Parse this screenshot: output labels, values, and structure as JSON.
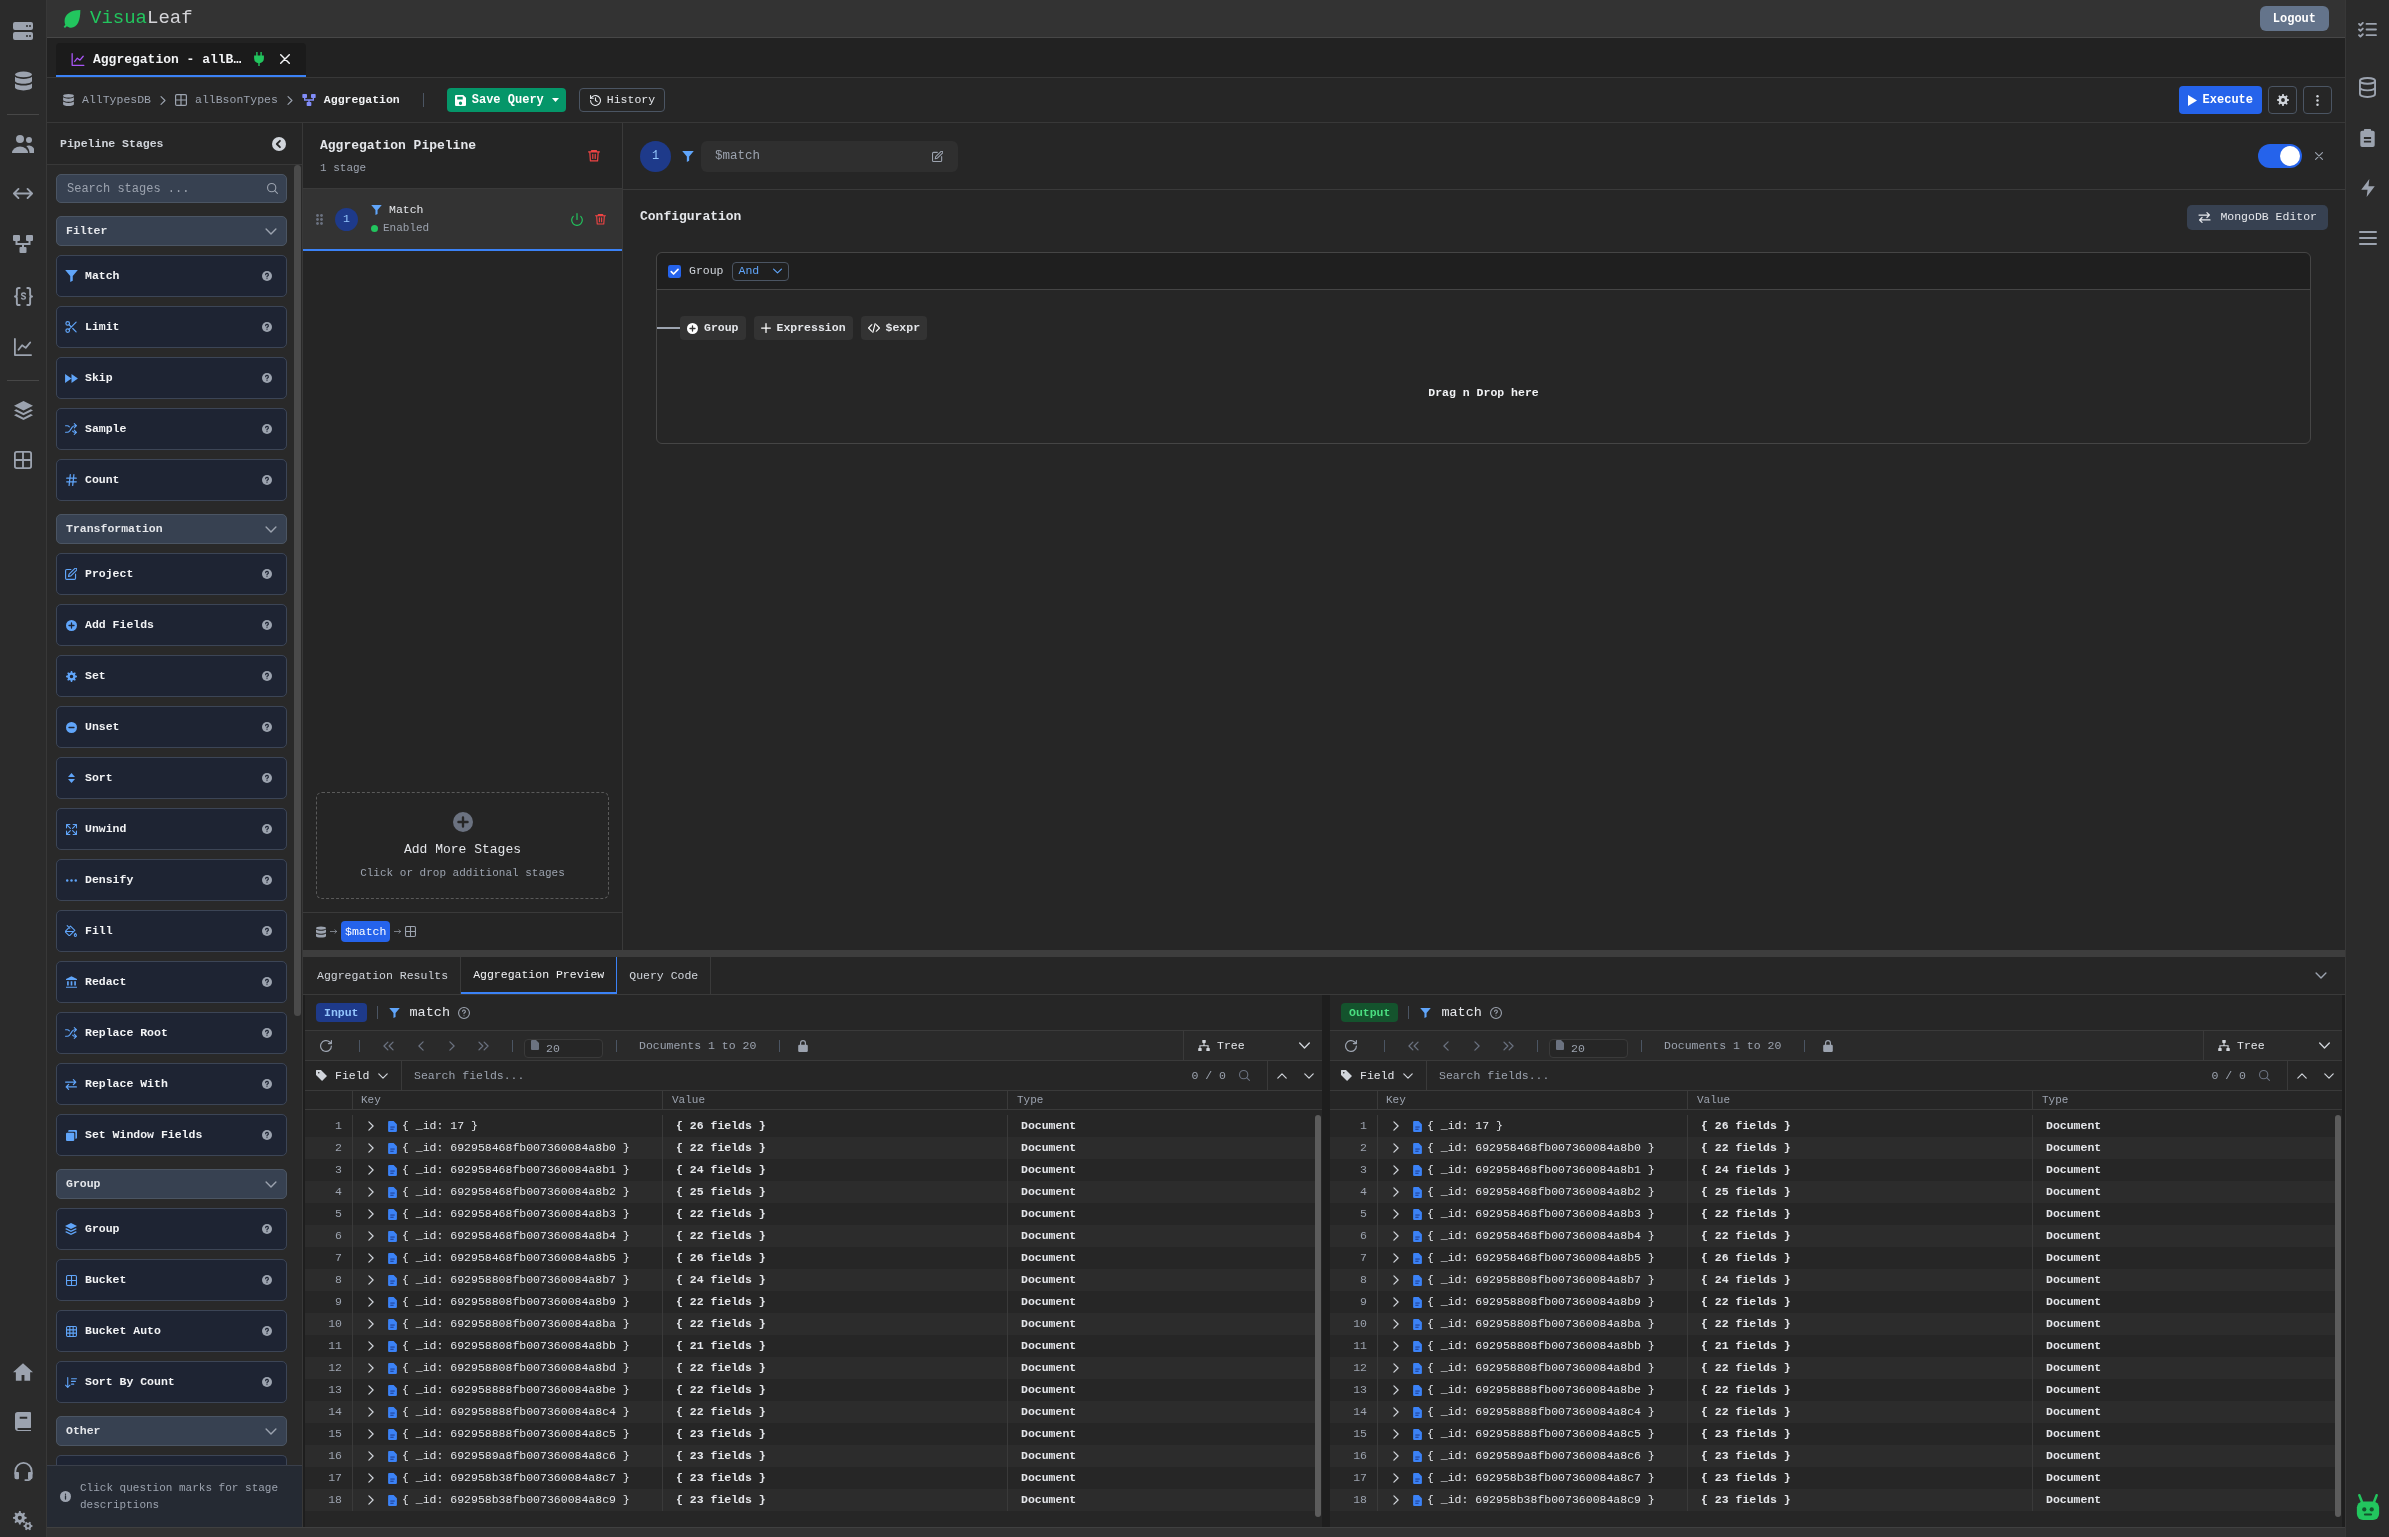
{
  "header": {
    "logo": {
      "accent": "Visua",
      "rest": "Leaf"
    },
    "logout": "Logout"
  },
  "tabs": [
    {
      "label": "Aggregation - allB…",
      "selected": true,
      "connected": true
    }
  ],
  "breadcrumb": [
    {
      "kind": "database",
      "label": "AllTypesDB"
    },
    {
      "kind": "collection",
      "label": "allBsonTypes"
    },
    {
      "kind": "pipeline",
      "label": "Aggregation"
    }
  ],
  "toolbar": {
    "save": "Save Query",
    "history": "History",
    "execute": "Execute"
  },
  "stage_palette": {
    "title": "Pipeline Stages",
    "search": {
      "placeholder": "Search stages ..."
    },
    "categories": [
      {
        "label": "Filter",
        "expanded": true,
        "stages": [
          "Match",
          "Limit",
          "Skip",
          "Sample",
          "Count"
        ]
      },
      {
        "label": "Transformation",
        "expanded": true,
        "stages": [
          "Project",
          "Add Fields",
          "Set",
          "Unset",
          "Sort",
          "Unwind",
          "Densify",
          "Fill",
          "Redact",
          "Replace Root",
          "Replace With",
          "Set Window Fields"
        ]
      },
      {
        "label": "Group",
        "expanded": true,
        "stages": [
          "Group",
          "Bucket",
          "Bucket Auto",
          "Sort By Count"
        ]
      },
      {
        "label": "Other",
        "expanded": true
      }
    ],
    "hint": "Click question marks for stage descriptions"
  },
  "pipeline": {
    "title": "Aggregation Pipeline",
    "summary": "1 stage",
    "stages": [
      {
        "number": "1",
        "name": "Match",
        "status": "Enabled",
        "enabled": true,
        "selected": true
      }
    ],
    "add_stage": {
      "title": "Add More Stages",
      "hint": "Click or drop additional stages"
    },
    "flow": [
      "$match"
    ]
  },
  "editor": {
    "number": "1",
    "operator": "$match",
    "enabled": true,
    "section": "Configuration",
    "mode_button": "MongoDB Editor",
    "group": {
      "checked": true,
      "label": "Group",
      "combinator": "And",
      "actions": [
        {
          "kind": "group",
          "label": "Group"
        },
        {
          "kind": "expression",
          "label": "Expression"
        },
        {
          "kind": "expr",
          "label": "$expr"
        }
      ],
      "drop_hint": "Drag n Drop here"
    }
  },
  "results": {
    "tabs": [
      {
        "label": "Aggregation Results",
        "selected": false
      },
      {
        "label": "Aggregation Preview",
        "selected": true
      },
      {
        "label": "Query Code",
        "selected": false
      }
    ],
    "panes": [
      {
        "kind": "input",
        "badge": "Input",
        "stage": "match",
        "page_size": "20",
        "range": "Documents 1 to 20",
        "view": "Tree",
        "filter_field": "Field",
        "search": {
          "placeholder": "Search fields..."
        },
        "match_count": "0 / 0",
        "columns": [
          "Key",
          "Value",
          "Type"
        ],
        "rows": [
          {
            "number": "1",
            "key": "{ _id: 17 }",
            "value": "{ 26 fields }",
            "type": "Document",
            "expanded": false
          },
          {
            "number": "2",
            "key": "{ _id: 692958468fb007360084a8b0 }",
            "value": "{ 22 fields }",
            "type": "Document",
            "expanded": false
          },
          {
            "number": "3",
            "key": "{ _id: 692958468fb007360084a8b1 }",
            "value": "{ 24 fields }",
            "type": "Document",
            "expanded": false
          },
          {
            "number": "4",
            "key": "{ _id: 692958468fb007360084a8b2 }",
            "value": "{ 25 fields }",
            "type": "Document",
            "expanded": false
          },
          {
            "number": "5",
            "key": "{ _id: 692958468fb007360084a8b3 }",
            "value": "{ 22 fields }",
            "type": "Document",
            "expanded": false
          },
          {
            "number": "6",
            "key": "{ _id: 692958468fb007360084a8b4 }",
            "value": "{ 22 fields }",
            "type": "Document",
            "expanded": false
          },
          {
            "number": "7",
            "key": "{ _id: 692958468fb007360084a8b5 }",
            "value": "{ 26 fields }",
            "type": "Document",
            "expanded": false
          },
          {
            "number": "8",
            "key": "{ _id: 692958808fb007360084a8b7 }",
            "value": "{ 24 fields }",
            "type": "Document",
            "expanded": false
          },
          {
            "number": "9",
            "key": "{ _id: 692958808fb007360084a8b9 }",
            "value": "{ 22 fields }",
            "type": "Document",
            "expanded": false
          },
          {
            "number": "10",
            "key": "{ _id: 692958808fb007360084a8ba }",
            "value": "{ 22 fields }",
            "type": "Document",
            "expanded": false
          },
          {
            "number": "11",
            "key": "{ _id: 692958808fb007360084a8bb }",
            "value": "{ 21 fields }",
            "type": "Document",
            "expanded": false
          },
          {
            "number": "12",
            "key": "{ _id: 692958808fb007360084a8bd }",
            "value": "{ 22 fields }",
            "type": "Document",
            "expanded": false
          },
          {
            "number": "13",
            "key": "{ _id: 692958888fb007360084a8be }",
            "value": "{ 22 fields }",
            "type": "Document",
            "expanded": false
          },
          {
            "number": "14",
            "key": "{ _id: 692958888fb007360084a8c4 }",
            "value": "{ 22 fields }",
            "type": "Document",
            "expanded": false
          },
          {
            "number": "15",
            "key": "{ _id: 692958888fb007360084a8c5 }",
            "value": "{ 23 fields }",
            "type": "Document",
            "expanded": false
          },
          {
            "number": "16",
            "key": "{ _id: 6929589a8fb007360084a8c6 }",
            "value": "{ 23 fields }",
            "type": "Document",
            "expanded": false
          },
          {
            "number": "17",
            "key": "{ _id: 692958b38fb007360084a8c7 }",
            "value": "{ 23 fields }",
            "type": "Document",
            "expanded": false
          },
          {
            "number": "18",
            "key": "{ _id: 692958b38fb007360084a8c9 }",
            "value": "{ 23 fields }",
            "type": "Document",
            "expanded": false
          }
        ]
      },
      {
        "kind": "output",
        "badge": "Output",
        "stage": "match",
        "page_size": "20",
        "range": "Documents 1 to 20",
        "view": "Tree",
        "filter_field": "Field",
        "search": {
          "placeholder": "Search fields..."
        },
        "match_count": "0 / 0",
        "columns": [
          "Key",
          "Value",
          "Type"
        ],
        "rows": [
          {
            "number": "1",
            "key": "{ _id: 17 }",
            "value": "{ 26 fields }",
            "type": "Document",
            "expanded": false
          },
          {
            "number": "2",
            "key": "{ _id: 692958468fb007360084a8b0 }",
            "value": "{ 22 fields }",
            "type": "Document",
            "expanded": false
          },
          {
            "number": "3",
            "key": "{ _id: 692958468fb007360084a8b1 }",
            "value": "{ 24 fields }",
            "type": "Document",
            "expanded": false
          },
          {
            "number": "4",
            "key": "{ _id: 692958468fb007360084a8b2 }",
            "value": "{ 25 fields }",
            "type": "Document",
            "expanded": false
          },
          {
            "number": "5",
            "key": "{ _id: 692958468fb007360084a8b3 }",
            "value": "{ 22 fields }",
            "type": "Document",
            "expanded": false
          },
          {
            "number": "6",
            "key": "{ _id: 692958468fb007360084a8b4 }",
            "value": "{ 22 fields }",
            "type": "Document",
            "expanded": false
          },
          {
            "number": "7",
            "key": "{ _id: 692958468fb007360084a8b5 }",
            "value": "{ 26 fields }",
            "type": "Document",
            "expanded": false
          },
          {
            "number": "8",
            "key": "{ _id: 692958808fb007360084a8b7 }",
            "value": "{ 24 fields }",
            "type": "Document",
            "expanded": false
          },
          {
            "number": "9",
            "key": "{ _id: 692958808fb007360084a8b9 }",
            "value": "{ 22 fields }",
            "type": "Document",
            "expanded": false
          },
          {
            "number": "10",
            "key": "{ _id: 692958808fb007360084a8ba }",
            "value": "{ 22 fields }",
            "type": "Document",
            "expanded": false
          },
          {
            "number": "11",
            "key": "{ _id: 692958808fb007360084a8bb }",
            "value": "{ 21 fields }",
            "type": "Document",
            "expanded": false
          },
          {
            "number": "12",
            "key": "{ _id: 692958808fb007360084a8bd }",
            "value": "{ 22 fields }",
            "type": "Document",
            "expanded": false
          },
          {
            "number": "13",
            "key": "{ _id: 692958888fb007360084a8be }",
            "value": "{ 22 fields }",
            "type": "Document",
            "expanded": false
          },
          {
            "number": "14",
            "key": "{ _id: 692958888fb007360084a8c4 }",
            "value": "{ 22 fields }",
            "type": "Document",
            "expanded": false
          },
          {
            "number": "15",
            "key": "{ _id: 692958888fb007360084a8c5 }",
            "value": "{ 23 fields }",
            "type": "Document",
            "expanded": false
          },
          {
            "number": "16",
            "key": "{ _id: 6929589a8fb007360084a8c6 }",
            "value": "{ 23 fields }",
            "type": "Document",
            "expanded": false
          },
          {
            "number": "17",
            "key": "{ _id: 692958b38fb007360084a8c7 }",
            "value": "{ 23 fields }",
            "type": "Document",
            "expanded": false
          },
          {
            "number": "18",
            "key": "{ _id: 692958b38fb007360084a8c9 }",
            "value": "{ 23 fields }",
            "type": "Document",
            "expanded": false
          }
        ]
      }
    ]
  }
}
